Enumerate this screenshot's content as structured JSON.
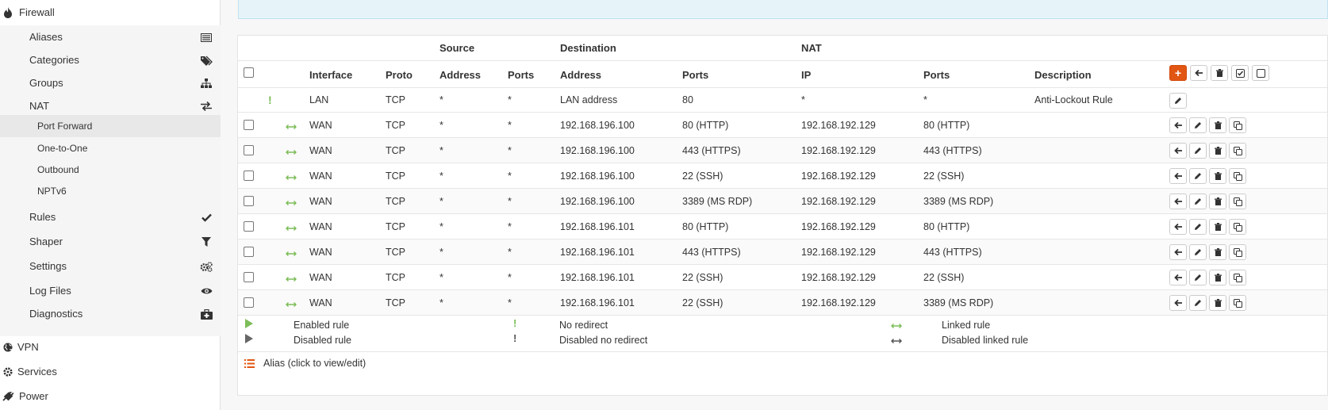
{
  "sidebar": {
    "firewall": "Firewall",
    "aliases": "Aliases",
    "categories": "Categories",
    "groups": "Groups",
    "nat": "NAT",
    "port_forward": "Port Forward",
    "one_to_one": "One-to-One",
    "outbound": "Outbound",
    "nptv6": "NPTv6",
    "rules": "Rules",
    "shaper": "Shaper",
    "settings": "Settings",
    "log_files": "Log Files",
    "diagnostics": "Diagnostics",
    "vpn": "VPN",
    "services": "Services",
    "power": "Power"
  },
  "table": {
    "group_headers": {
      "source": "Source",
      "destination": "Destination",
      "nat": "NAT"
    },
    "headers": {
      "interface": "Interface",
      "proto": "Proto",
      "src_address": "Address",
      "src_ports": "Ports",
      "dst_address": "Address",
      "dst_ports": "Ports",
      "nat_ip": "IP",
      "nat_ports": "Ports",
      "description": "Description"
    },
    "anti_lockout": {
      "interface": "LAN",
      "proto": "TCP",
      "src_address": "*",
      "src_ports": "*",
      "dst_address": "LAN address",
      "dst_ports": "80",
      "nat_ip": "*",
      "nat_ports": "*",
      "description": "Anti-Lockout Rule"
    },
    "rows": [
      {
        "interface": "WAN",
        "proto": "TCP",
        "src_address": "*",
        "src_ports": "*",
        "dst_address": "192.168.196.100",
        "dst_ports": "80 (HTTP)",
        "nat_ip": "192.168.192.129",
        "nat_ports": "80 (HTTP)"
      },
      {
        "interface": "WAN",
        "proto": "TCP",
        "src_address": "*",
        "src_ports": "*",
        "dst_address": "192.168.196.100",
        "dst_ports": "443 (HTTPS)",
        "nat_ip": "192.168.192.129",
        "nat_ports": "443 (HTTPS)"
      },
      {
        "interface": "WAN",
        "proto": "TCP",
        "src_address": "*",
        "src_ports": "*",
        "dst_address": "192.168.196.100",
        "dst_ports": "22 (SSH)",
        "nat_ip": "192.168.192.129",
        "nat_ports": "22 (SSH)"
      },
      {
        "interface": "WAN",
        "proto": "TCP",
        "src_address": "*",
        "src_ports": "*",
        "dst_address": "192.168.196.100",
        "dst_ports": "3389 (MS RDP)",
        "nat_ip": "192.168.192.129",
        "nat_ports": "3389 (MS RDP)"
      },
      {
        "interface": "WAN",
        "proto": "TCP",
        "src_address": "*",
        "src_ports": "*",
        "dst_address": "192.168.196.101",
        "dst_ports": "80 (HTTP)",
        "nat_ip": "192.168.192.129",
        "nat_ports": "80 (HTTP)"
      },
      {
        "interface": "WAN",
        "proto": "TCP",
        "src_address": "*",
        "src_ports": "*",
        "dst_address": "192.168.196.101",
        "dst_ports": "443 (HTTPS)",
        "nat_ip": "192.168.192.129",
        "nat_ports": "443 (HTTPS)"
      },
      {
        "interface": "WAN",
        "proto": "TCP",
        "src_address": "*",
        "src_ports": "*",
        "dst_address": "192.168.196.101",
        "dst_ports": "22 (SSH)",
        "nat_ip": "192.168.192.129",
        "nat_ports": "22 (SSH)"
      },
      {
        "interface": "WAN",
        "proto": "TCP",
        "src_address": "*",
        "src_ports": "*",
        "dst_address": "192.168.196.101",
        "dst_ports": "22 (SSH)",
        "nat_ip": "192.168.192.129",
        "nat_ports": "3389 (MS RDP)"
      }
    ]
  },
  "legend": {
    "enabled_rule": "Enabled rule",
    "disabled_rule": "Disabled rule",
    "no_redirect": "No redirect",
    "disabled_no_redirect": "Disabled no redirect",
    "linked_rule": "Linked rule",
    "disabled_linked_rule": "Disabled linked rule",
    "alias": "Alias (click to view/edit)"
  },
  "colors": {
    "accent": "#e15613",
    "enabled": "#7cbd58",
    "info_bg": "#e6f4fa"
  }
}
